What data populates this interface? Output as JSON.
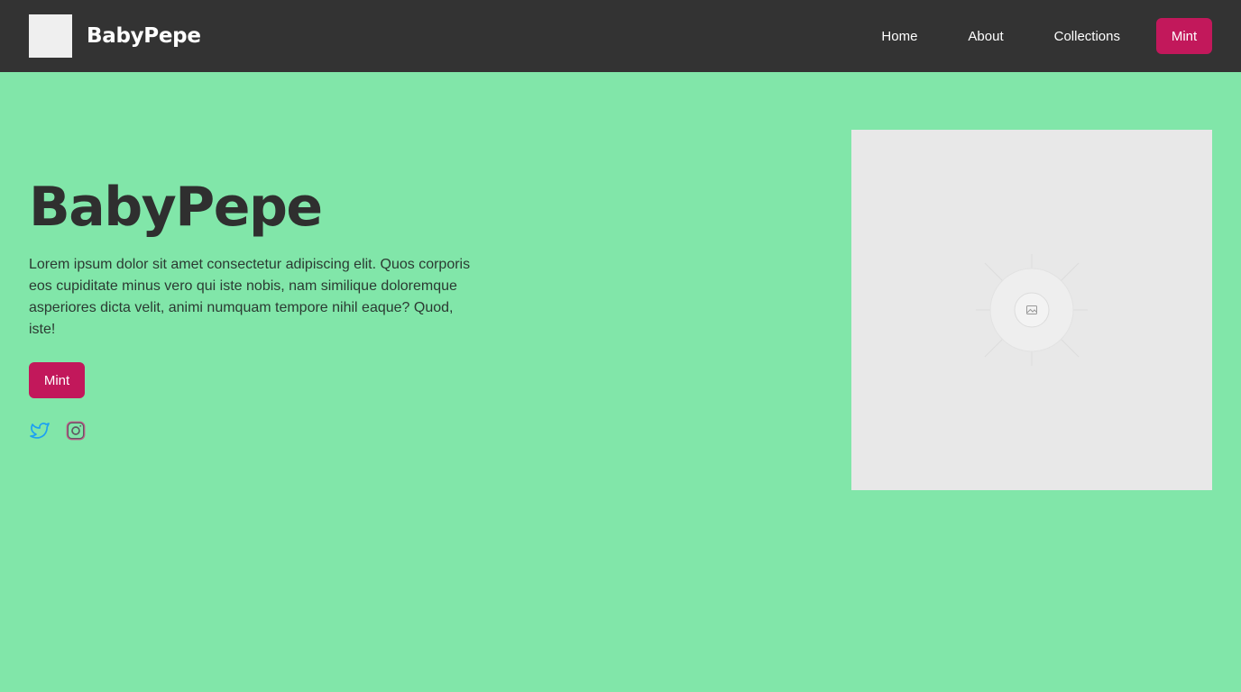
{
  "nav": {
    "brand": "BabyPepe",
    "links": [
      "Home",
      "About",
      "Collections"
    ],
    "mint_label": "Mint"
  },
  "hero": {
    "title": "BabyPepe",
    "description": "Lorem ipsum dolor sit amet consectetur adipiscing elit. Quos corporis eos cupiditate minus vero qui iste nobis, nam similique doloremque asperiores dicta velit, animi numquam tempore nihil eaque? Quod, iste!",
    "mint_label": "Mint"
  },
  "colors": {
    "background": "#81e6a9",
    "navbar": "#333333",
    "accent": "#c2185b",
    "twitter": "#1da1f2"
  },
  "icons": {
    "twitter": "twitter-icon",
    "instagram": "instagram-icon",
    "image_placeholder": "image-placeholder-icon"
  }
}
